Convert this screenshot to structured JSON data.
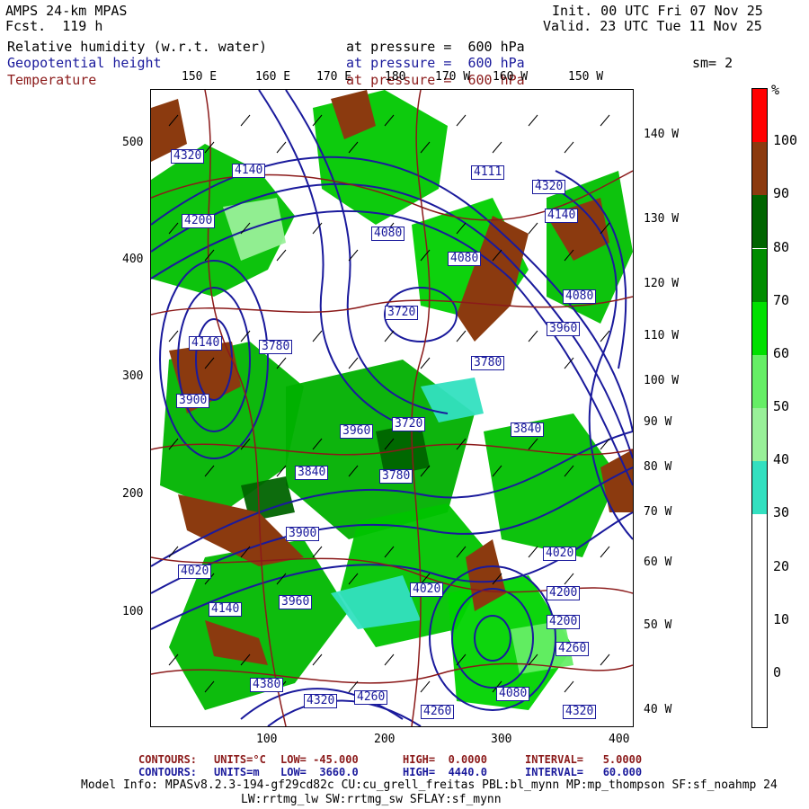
{
  "header": {
    "model": "AMPS 24-km MPAS",
    "fcst": "Fcst.  119 h",
    "init": "Init. 00 UTC Fri 07 Nov 25",
    "valid": "Valid. 23 UTC Tue 11 Nov 25",
    "fields": [
      {
        "name": "Relative humidity (w.r.t. water)",
        "level": "at pressure =  600 hPa"
      },
      {
        "name": "Geopotential height",
        "level": "at pressure =  600 hPa"
      },
      {
        "name": "Temperature",
        "level": "at pressure =  600 hPa"
      }
    ],
    "smooth": "sm= 2"
  },
  "axes": {
    "lon_top": [
      "150 E",
      "160 E",
      "170 E",
      "180",
      "170 W",
      "160 W",
      "150 W"
    ],
    "lon_right": [
      "140 W",
      "130 W",
      "120 W",
      "110 W",
      "100 W",
      "90 W",
      "80 W",
      "70 W",
      "60 W",
      "50 W",
      "40 W"
    ],
    "x_ticks": [
      "100",
      "200",
      "300",
      "400"
    ],
    "y_ticks": [
      "500",
      "400",
      "300",
      "200",
      "100"
    ]
  },
  "colorbar": {
    "unit": "%",
    "labels": [
      "100",
      "90",
      "80",
      "70",
      "60",
      "50",
      "40",
      "30",
      "20",
      "10",
      "0"
    ],
    "colors": [
      "#ff0000",
      "#8b3a0f",
      "#006400",
      "#008c00",
      "#00e000",
      "#66ee66",
      "#99f099",
      "#33e0c0",
      "#ffffff",
      "#ffffff",
      "#ffffff",
      "#ffffff"
    ]
  },
  "height_labels": [
    "4320",
    "4140",
    "4200",
    "4080",
    "4111",
    "4320",
    "4140",
    "4080",
    "4080",
    "3960",
    "4140",
    "3780",
    "3720",
    "3780",
    "3900",
    "3840",
    "3960",
    "3720",
    "3840",
    "3780",
    "4020",
    "4140",
    "4020",
    "3900",
    "4020",
    "3960",
    "4200",
    "4200",
    "4260",
    "4080",
    "4260",
    "4320",
    "4320",
    "4380",
    "4260"
  ],
  "footer": {
    "line1": {
      "label": "CONTOURS:",
      "units": "UNITS=°C",
      "low": "LOW= -45.000",
      "high": "HIGH=  0.0000",
      "interval": "INTERVAL=   5.0000"
    },
    "line2": {
      "label": "CONTOURS:",
      "units": "UNITS=m",
      "low": "LOW=  3660.0",
      "high": "HIGH=  4440.0",
      "interval": "INTERVAL=   60.000"
    },
    "info1": "Model Info: MPASv8.2.3-194-gf29cd82c CU:cu_grell_freitas PBL:bl_mynn MP:mp_thompson SF:sf_noahmp 24",
    "info2": "LW:rrtmg_lw SW:rrtmg_sw SFLAY:sf_mynn"
  }
}
